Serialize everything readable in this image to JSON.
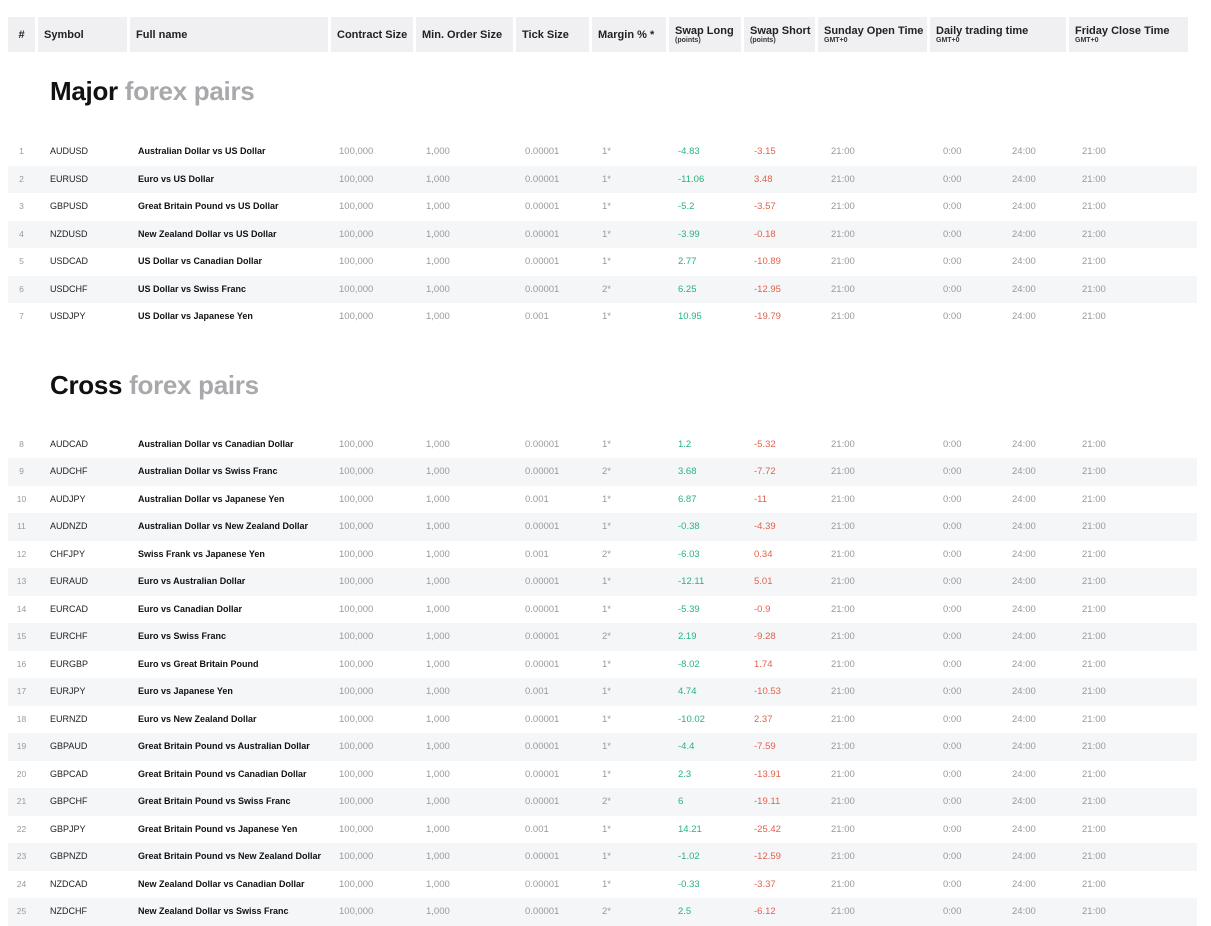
{
  "header": {
    "num": "#",
    "symbol": "Symbol",
    "full_name": "Full name",
    "contract_size": "Contract Size",
    "min_order_size": "Min. Order Size",
    "tick_size": "Tick Size",
    "margin": "Margin % *",
    "swap_long": "Swap Long",
    "swap_long_sub": "(points)",
    "swap_short": "Swap Short",
    "swap_short_sub": "(points)",
    "sunday_open": "Sunday Open Time",
    "sunday_open_sub": "GMT+0",
    "daily_trading": "Daily trading time",
    "daily_trading_sub": "GMT+0",
    "friday_close": "Friday Close Time",
    "friday_close_sub": "GMT+0"
  },
  "sections": [
    {
      "title_bold": "Major",
      "title_light": "forex pairs",
      "rows": [
        [
          "1",
          "AUDUSD",
          "Australian Dollar vs US Dollar",
          "100,000",
          "1,000",
          "0.00001",
          "1*",
          "-4.83",
          "-3.15",
          "21:00",
          "0:00",
          "24:00",
          "21:00"
        ],
        [
          "2",
          "EURUSD",
          "Euro vs US Dollar",
          "100,000",
          "1,000",
          "0.00001",
          "1*",
          "-11.06",
          "3.48",
          "21:00",
          "0:00",
          "24:00",
          "21:00"
        ],
        [
          "3",
          "GBPUSD",
          "Great Britain Pound vs US Dollar",
          "100,000",
          "1,000",
          "0.00001",
          "1*",
          "-5.2",
          "-3.57",
          "21:00",
          "0:00",
          "24:00",
          "21:00"
        ],
        [
          "4",
          "NZDUSD",
          "New Zealand Dollar vs US Dollar",
          "100,000",
          "1,000",
          "0.00001",
          "1*",
          "-3.99",
          "-0.18",
          "21:00",
          "0:00",
          "24:00",
          "21:00"
        ],
        [
          "5",
          "USDCAD",
          "US Dollar vs Canadian Dollar",
          "100,000",
          "1,000",
          "0.00001",
          "1*",
          "2.77",
          "-10.89",
          "21:00",
          "0:00",
          "24:00",
          "21:00"
        ],
        [
          "6",
          "USDCHF",
          "US Dollar vs Swiss Franc",
          "100,000",
          "1,000",
          "0.00001",
          "2*",
          "6.25",
          "-12.95",
          "21:00",
          "0:00",
          "24:00",
          "21:00"
        ],
        [
          "7",
          "USDJPY",
          "US Dollar vs Japanese Yen",
          "100,000",
          "1,000",
          "0.001",
          "1*",
          "10.95",
          "-19.79",
          "21:00",
          "0:00",
          "24:00",
          "21:00"
        ]
      ]
    },
    {
      "title_bold": "Cross",
      "title_light": "forex pairs",
      "rows": [
        [
          "8",
          "AUDCAD",
          "Australian Dollar vs Canadian Dollar",
          "100,000",
          "1,000",
          "0.00001",
          "1*",
          "1.2",
          "-5.32",
          "21:00",
          "0:00",
          "24:00",
          "21:00"
        ],
        [
          "9",
          "AUDCHF",
          "Australian Dollar vs Swiss Franc",
          "100,000",
          "1,000",
          "0.00001",
          "2*",
          "3.68",
          "-7.72",
          "21:00",
          "0:00",
          "24:00",
          "21:00"
        ],
        [
          "10",
          "AUDJPY",
          "Australian Dollar vs Japanese Yen",
          "100,000",
          "1,000",
          "0.001",
          "1*",
          "6.87",
          "-11",
          "21:00",
          "0:00",
          "24:00",
          "21:00"
        ],
        [
          "11",
          "AUDNZD",
          "Australian Dollar vs New Zealand Dollar",
          "100,000",
          "1,000",
          "0.00001",
          "1*",
          "-0.38",
          "-4.39",
          "21:00",
          "0:00",
          "24:00",
          "21:00"
        ],
        [
          "12",
          "CHFJPY",
          "Swiss Frank vs Japanese Yen",
          "100,000",
          "1,000",
          "0.001",
          "2*",
          "-6.03",
          "0.34",
          "21:00",
          "0:00",
          "24:00",
          "21:00"
        ],
        [
          "13",
          "EURAUD",
          "Euro vs Australian Dollar",
          "100,000",
          "1,000",
          "0.00001",
          "1*",
          "-12.11",
          "5.01",
          "21:00",
          "0:00",
          "24:00",
          "21:00"
        ],
        [
          "14",
          "EURCAD",
          "Euro vs Canadian Dollar",
          "100,000",
          "1,000",
          "0.00001",
          "1*",
          "-5.39",
          "-0.9",
          "21:00",
          "0:00",
          "24:00",
          "21:00"
        ],
        [
          "15",
          "EURCHF",
          "Euro vs Swiss Franc",
          "100,000",
          "1,000",
          "0.00001",
          "2*",
          "2.19",
          "-9.28",
          "21:00",
          "0:00",
          "24:00",
          "21:00"
        ],
        [
          "16",
          "EURGBP",
          "Euro vs Great Britain Pound",
          "100,000",
          "1,000",
          "0.00001",
          "1*",
          "-8.02",
          "1.74",
          "21:00",
          "0:00",
          "24:00",
          "21:00"
        ],
        [
          "17",
          "EURJPY",
          "Euro vs Japanese Yen",
          "100,000",
          "1,000",
          "0.001",
          "1*",
          "4.74",
          "-10.53",
          "21:00",
          "0:00",
          "24:00",
          "21:00"
        ],
        [
          "18",
          "EURNZD",
          "Euro vs New Zealand Dollar",
          "100,000",
          "1,000",
          "0.00001",
          "1*",
          "-10.02",
          "2.37",
          "21:00",
          "0:00",
          "24:00",
          "21:00"
        ],
        [
          "19",
          "GBPAUD",
          "Great Britain Pound vs Australian Dollar",
          "100,000",
          "1,000",
          "0.00001",
          "1*",
          "-4.4",
          "-7.59",
          "21:00",
          "0:00",
          "24:00",
          "21:00"
        ],
        [
          "20",
          "GBPCAD",
          "Great Britain Pound vs Canadian Dollar",
          "100,000",
          "1,000",
          "0.00001",
          "1*",
          "2.3",
          "-13.91",
          "21:00",
          "0:00",
          "24:00",
          "21:00"
        ],
        [
          "21",
          "GBPCHF",
          "Great Britain Pound vs Swiss Franc",
          "100,000",
          "1,000",
          "0.00001",
          "2*",
          "6",
          "-19.11",
          "21:00",
          "0:00",
          "24:00",
          "21:00"
        ],
        [
          "22",
          "GBPJPY",
          "Great Britain Pound vs Japanese Yen",
          "100,000",
          "1,000",
          "0.001",
          "1*",
          "14.21",
          "-25.42",
          "21:00",
          "0:00",
          "24:00",
          "21:00"
        ],
        [
          "23",
          "GBPNZD",
          "Great Britain Pound vs New Zealand Dollar",
          "100,000",
          "1,000",
          "0.00001",
          "1*",
          "-1.02",
          "-12.59",
          "21:00",
          "0:00",
          "24:00",
          "21:00"
        ],
        [
          "24",
          "NZDCAD",
          "New Zealand Dollar vs Canadian Dollar",
          "100,000",
          "1,000",
          "0.00001",
          "1*",
          "-0.33",
          "-3.37",
          "21:00",
          "0:00",
          "24:00",
          "21:00"
        ],
        [
          "25",
          "NZDCHF",
          "New Zealand Dollar vs Swiss Franc",
          "100,000",
          "1,000",
          "0.00001",
          "2*",
          "2.5",
          "-6.12",
          "21:00",
          "0:00",
          "24:00",
          "21:00"
        ]
      ]
    }
  ],
  "colors": {
    "swap_positive_green": "#27b37d",
    "swap_negative_red": "#e4604b",
    "title_light_gray": "#a9a9ad",
    "header_bg": "#f0f0f2",
    "row_alt_bg": "#f5f6f8"
  }
}
